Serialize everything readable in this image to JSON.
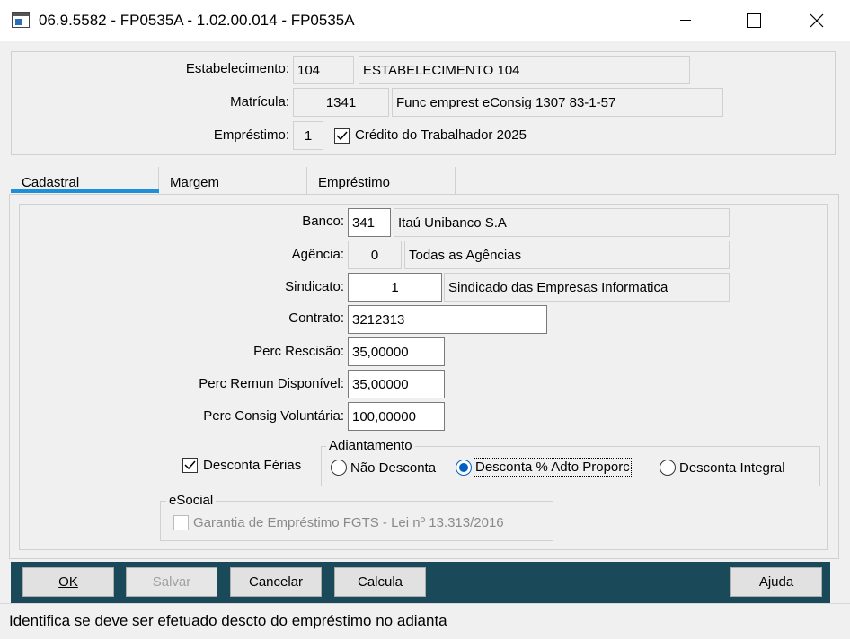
{
  "window": {
    "title": "06.9.5582 - FP0535A - 1.02.00.014 - FP0535A",
    "app_icon": "application-window-icon",
    "controls": [
      "minimize-icon",
      "maximize-icon",
      "close-icon"
    ]
  },
  "header": {
    "estabelecimento_label": "Estabelecimento:",
    "estabelecimento_code": "104",
    "estabelecimento_name": "ESTABELECIMENTO 104",
    "matricula_label": "Matrícula:",
    "matricula_code": "1341",
    "matricula_name": "Func emprest eConsig 1307 83-1-57",
    "emprestimo_label": "Empréstimo:",
    "emprestimo_code": "1",
    "credito_checkbox_label": "Crédito do Trabalhador 2025",
    "credito_checked": true
  },
  "tabs": [
    {
      "label": "Cadastral",
      "active": true
    },
    {
      "label": "Margem",
      "active": false
    },
    {
      "label": "Empréstimo",
      "active": false
    }
  ],
  "cadastral": {
    "banco_label": "Banco:",
    "banco_code": "341",
    "banco_name": "Itaú Unibanco S.A",
    "agencia_label": "Agência:",
    "agencia_code": "0",
    "agencia_name": "Todas as Agências",
    "sindicato_label": "Sindicato:",
    "sindicato_code": "1",
    "sindicato_name": "Sindicado das Empresas Informatica",
    "contrato_label": "Contrato:",
    "contrato_value": "3212313",
    "perc_rescisao_label": "Perc Rescisão:",
    "perc_rescisao_value": "35,00000",
    "perc_remun_label": "Perc Remun Disponível:",
    "perc_remun_value": "35,00000",
    "perc_consig_label": "Perc Consig Voluntária:",
    "perc_consig_value": "100,00000",
    "desconta_ferias_label": "Desconta Férias",
    "desconta_ferias_checked": true,
    "adiantamento": {
      "legend": "Adiantamento",
      "options": [
        {
          "label": "Não Desconta",
          "selected": false
        },
        {
          "label": "Desconta % Adto Proporc",
          "selected": true
        },
        {
          "label": "Desconta Integral",
          "selected": false
        }
      ]
    },
    "esocial": {
      "legend": "eSocial",
      "garantia_label": "Garantia de Empréstimo FGTS - Lei nº 13.313/2016",
      "garantia_checked": false
    }
  },
  "buttons": {
    "ok": "OK",
    "salvar": "Salvar",
    "cancelar": "Cancelar",
    "calcula": "Calcula",
    "ajuda": "Ajuda"
  },
  "status": {
    "text": "Identifica se deve ser efetuado descto do empréstimo no adianta"
  },
  "colors": {
    "accent": "#1e90d8",
    "button_bar": "#1a4a5a",
    "radio_selected": "#0060c0"
  }
}
